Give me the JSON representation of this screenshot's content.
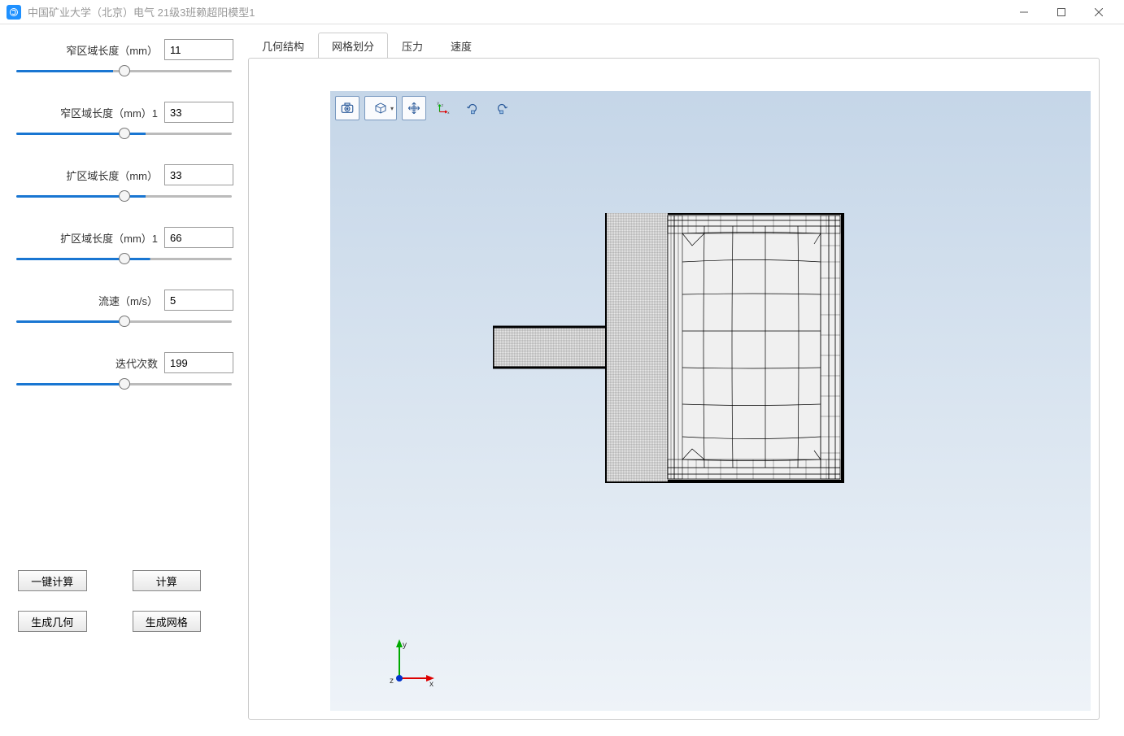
{
  "window": {
    "title": "中国矿业大学（北京）电气 21级3班赖超阳模型1"
  },
  "params": [
    {
      "label": "窄区域长度（mm）",
      "value": "11",
      "pct": 45
    },
    {
      "label": "窄区域长度（mm）1",
      "value": "33",
      "pct": 60
    },
    {
      "label": "扩区域长度（mm）",
      "value": "33",
      "pct": 60
    },
    {
      "label": "扩区域长度（mm）1",
      "value": "66",
      "pct": 62
    },
    {
      "label": "流速（m/s）",
      "value": "5",
      "pct": 48
    },
    {
      "label": "迭代次数",
      "value": "199",
      "pct": 50
    }
  ],
  "buttons": {
    "one_click": "一键计算",
    "compute": "计算",
    "gen_geometry": "生成几何",
    "gen_mesh": "生成网格"
  },
  "tabs": [
    {
      "label": "几何结构",
      "active": false
    },
    {
      "label": "网格划分",
      "active": true
    },
    {
      "label": "压力",
      "active": false
    },
    {
      "label": "速度",
      "active": false
    }
  ],
  "toolbar_icons": [
    "camera-icon",
    "cube-icon",
    "pan-icon",
    "axes-icon",
    "rotate-ccw-icon",
    "rotate-cw-icon"
  ],
  "axis": {
    "x": "x",
    "y": "y",
    "z": "z"
  }
}
